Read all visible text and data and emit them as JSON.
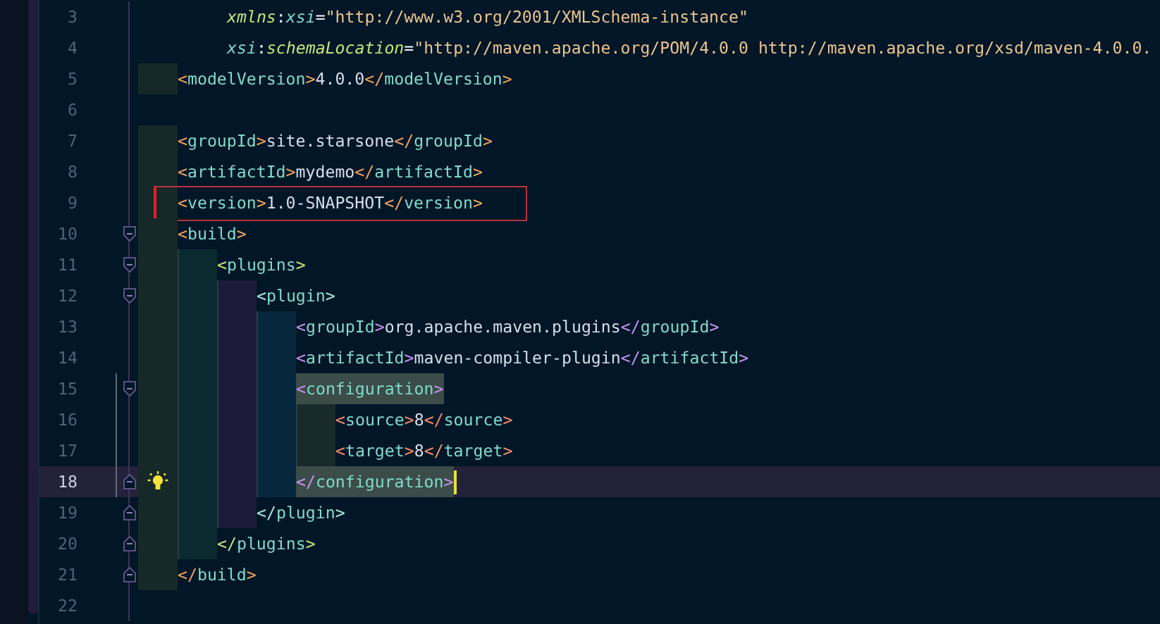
{
  "editor": {
    "lines": [
      {
        "number": "3",
        "kind": "attribute",
        "current": false,
        "boxed": false,
        "matched": false,
        "changed": false,
        "fold_close": false,
        "tokens": [
          {
            "kind": "attr-a",
            "text": "xmlns"
          },
          {
            "kind": "punct",
            "text": ":"
          },
          {
            "kind": "attr-b",
            "text": "xsi"
          },
          {
            "kind": "punct",
            "text": "="
          },
          {
            "kind": "value",
            "text": "\"http://www.w3.org/2001/XMLSchema-instance\""
          }
        ]
      },
      {
        "number": "4",
        "kind": "attribute",
        "current": false,
        "boxed": false,
        "matched": false,
        "changed": false,
        "fold_close": false,
        "tokens": [
          {
            "kind": "attr-b",
            "text": "xsi"
          },
          {
            "kind": "punct",
            "text": ":"
          },
          {
            "kind": "attr-a",
            "text": "schemaLocation"
          },
          {
            "kind": "punct",
            "text": "="
          },
          {
            "kind": "value",
            "text": "\"http://maven.apache.org/POM/4.0.0 http://maven.apache.org/xsd/maven-4.0.0."
          }
        ]
      },
      {
        "number": "5",
        "kind": "element",
        "current": false,
        "boxed": false,
        "matched": false,
        "changed": false,
        "fold_close": false,
        "tokens": [
          {
            "kind": "bracket",
            "text": "<"
          },
          {
            "kind": "tag",
            "text": "modelVersion"
          },
          {
            "kind": "bracket",
            "text": ">"
          },
          {
            "kind": "text",
            "text": "4.0.0"
          },
          {
            "kind": "bracket",
            "text": "</"
          },
          {
            "kind": "tag",
            "text": "modelVersion"
          },
          {
            "kind": "bracket",
            "text": ">"
          }
        ]
      },
      {
        "number": "6",
        "kind": "blank",
        "current": false,
        "boxed": false,
        "matched": false,
        "changed": false,
        "fold_close": false
      },
      {
        "number": "7",
        "kind": "element",
        "current": false,
        "boxed": false,
        "matched": false,
        "changed": false,
        "fold_close": false,
        "tokens": [
          {
            "kind": "bracket",
            "text": "<"
          },
          {
            "kind": "tag",
            "text": "groupId"
          },
          {
            "kind": "bracket",
            "text": ">"
          },
          {
            "kind": "text",
            "text": "site.starsone"
          },
          {
            "kind": "bracket",
            "text": "</"
          },
          {
            "kind": "tag",
            "text": "groupId"
          },
          {
            "kind": "bracket",
            "text": ">"
          }
        ]
      },
      {
        "number": "8",
        "kind": "element",
        "current": false,
        "boxed": false,
        "matched": false,
        "changed": false,
        "fold_close": false,
        "tokens": [
          {
            "kind": "bracket",
            "text": "<"
          },
          {
            "kind": "tag",
            "text": "artifactId"
          },
          {
            "kind": "bracket",
            "text": ">"
          },
          {
            "kind": "text",
            "text": "mydemo"
          },
          {
            "kind": "bracket",
            "text": "</"
          },
          {
            "kind": "tag",
            "text": "artifactId"
          },
          {
            "kind": "bracket",
            "text": ">"
          }
        ]
      },
      {
        "number": "9",
        "kind": "element",
        "current": false,
        "boxed": true,
        "matched": false,
        "changed": false,
        "fold_close": false,
        "tokens": [
          {
            "kind": "bracket",
            "text": "<"
          },
          {
            "kind": "tag",
            "text": "version"
          },
          {
            "kind": "bracket",
            "text": ">"
          },
          {
            "kind": "text",
            "text": "1.0-SNAPSHOT"
          },
          {
            "kind": "bracket",
            "text": "</"
          },
          {
            "kind": "tag",
            "text": "version"
          },
          {
            "kind": "bracket",
            "text": ">"
          }
        ]
      },
      {
        "number": "10",
        "kind": "element",
        "current": false,
        "boxed": false,
        "matched": false,
        "changed": false,
        "fold_close": false,
        "tokens": [
          {
            "kind": "bracket",
            "text": "<"
          },
          {
            "kind": "tag",
            "text": "build"
          },
          {
            "kind": "bracket",
            "text": ">"
          }
        ],
        "children": [
          {
            "number": "11",
            "kind": "element",
            "current": false,
            "boxed": false,
            "matched": false,
            "changed": false,
            "fold_close": false,
            "tokens": [
              {
                "kind": "bracket",
                "text": "<"
              },
              {
                "kind": "tag",
                "text": "plugins"
              },
              {
                "kind": "bracket",
                "text": ">"
              }
            ],
            "children": [
              {
                "number": "12",
                "kind": "element",
                "current": false,
                "boxed": false,
                "matched": false,
                "changed": false,
                "fold_close": false,
                "tokens": [
                  {
                    "kind": "bracket",
                    "text": "<"
                  },
                  {
                    "kind": "tag",
                    "text": "plugin"
                  },
                  {
                    "kind": "bracket",
                    "text": ">"
                  }
                ],
                "children": [
                  {
                    "number": "13",
                    "kind": "element",
                    "current": false,
                    "boxed": false,
                    "matched": false,
                    "changed": false,
                    "fold_close": false,
                    "tokens": [
                      {
                        "kind": "bracket",
                        "text": "<"
                      },
                      {
                        "kind": "tag",
                        "text": "groupId"
                      },
                      {
                        "kind": "bracket",
                        "text": ">"
                      },
                      {
                        "kind": "text",
                        "text": "org.apache.maven.plugins"
                      },
                      {
                        "kind": "bracket",
                        "text": "</"
                      },
                      {
                        "kind": "tag",
                        "text": "groupId"
                      },
                      {
                        "kind": "bracket",
                        "text": ">"
                      }
                    ]
                  },
                  {
                    "number": "14",
                    "kind": "element",
                    "current": false,
                    "boxed": false,
                    "matched": false,
                    "changed": false,
                    "fold_close": false,
                    "tokens": [
                      {
                        "kind": "bracket",
                        "text": "<"
                      },
                      {
                        "kind": "tag",
                        "text": "artifactId"
                      },
                      {
                        "kind": "bracket",
                        "text": ">"
                      },
                      {
                        "kind": "text",
                        "text": "maven-compiler-plugin"
                      },
                      {
                        "kind": "bracket",
                        "text": "</"
                      },
                      {
                        "kind": "tag",
                        "text": "artifactId"
                      },
                      {
                        "kind": "bracket",
                        "text": ">"
                      }
                    ]
                  },
                  {
                    "number": "15",
                    "kind": "element",
                    "current": false,
                    "boxed": false,
                    "matched": true,
                    "changed": true,
                    "fold_close": false,
                    "tokens": [
                      {
                        "kind": "bracket",
                        "text": "<"
                      },
                      {
                        "kind": "tag",
                        "text": "configuration"
                      },
                      {
                        "kind": "bracket",
                        "text": ">"
                      }
                    ],
                    "children": [
                      {
                        "number": "16",
                        "kind": "element",
                        "current": false,
                        "boxed": false,
                        "matched": false,
                        "changed": true,
                        "fold_close": false,
                        "tokens": [
                          {
                            "kind": "bracket",
                            "text": "<"
                          },
                          {
                            "kind": "tag",
                            "text": "source"
                          },
                          {
                            "kind": "bracket",
                            "text": ">"
                          },
                          {
                            "kind": "text",
                            "text": "8"
                          },
                          {
                            "kind": "bracket",
                            "text": "</"
                          },
                          {
                            "kind": "tag",
                            "text": "source"
                          },
                          {
                            "kind": "bracket",
                            "text": ">"
                          }
                        ]
                      },
                      {
                        "number": "17",
                        "kind": "element",
                        "current": false,
                        "boxed": false,
                        "matched": false,
                        "changed": true,
                        "fold_close": false,
                        "tokens": [
                          {
                            "kind": "bracket",
                            "text": "<"
                          },
                          {
                            "kind": "tag",
                            "text": "target"
                          },
                          {
                            "kind": "bracket",
                            "text": ">"
                          },
                          {
                            "kind": "text",
                            "text": "8"
                          },
                          {
                            "kind": "bracket",
                            "text": "</"
                          },
                          {
                            "kind": "tag",
                            "text": "target"
                          },
                          {
                            "kind": "bracket",
                            "text": ">"
                          }
                        ]
                      }
                    ]
                  },
                  {
                    "number": "18",
                    "kind": "element",
                    "current": true,
                    "boxed": false,
                    "matched": true,
                    "changed": true,
                    "fold_close": true,
                    "tokens": [
                      {
                        "kind": "bracket",
                        "text": "</"
                      },
                      {
                        "kind": "tag",
                        "text": "configuration"
                      },
                      {
                        "kind": "bracket",
                        "text": ">"
                      }
                    ]
                  }
                ]
              },
              {
                "number": "19",
                "kind": "element",
                "current": false,
                "boxed": false,
                "matched": false,
                "changed": false,
                "fold_close": true,
                "tokens": [
                  {
                    "kind": "bracket",
                    "text": "</"
                  },
                  {
                    "kind": "tag",
                    "text": "plugin"
                  },
                  {
                    "kind": "bracket",
                    "text": ">"
                  }
                ]
              }
            ]
          },
          {
            "number": "20",
            "kind": "element",
            "current": false,
            "boxed": false,
            "matched": false,
            "changed": false,
            "fold_close": true,
            "tokens": [
              {
                "kind": "bracket",
                "text": "</"
              },
              {
                "kind": "tag",
                "text": "plugins"
              },
              {
                "kind": "bracket",
                "text": ">"
              }
            ]
          }
        ]
      },
      {
        "number": "21",
        "kind": "element",
        "current": false,
        "boxed": false,
        "matched": false,
        "changed": false,
        "fold_close": true,
        "tokens": [
          {
            "kind": "bracket",
            "text": "</"
          },
          {
            "kind": "tag",
            "text": "build"
          },
          {
            "kind": "bracket",
            "text": ">"
          }
        ]
      },
      {
        "number": "22",
        "kind": "blank",
        "current": false,
        "boxed": false,
        "matched": false,
        "changed": false,
        "fold_close": false
      }
    ]
  }
}
